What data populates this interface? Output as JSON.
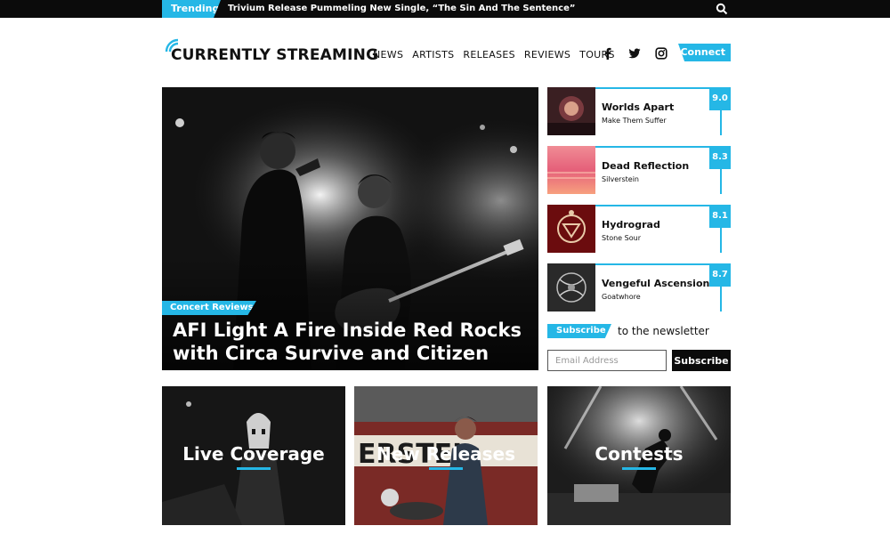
{
  "trending": {
    "label": "Trending",
    "headline": "Trivium Release Pummeling New Single, “The Sin And The Sentence”"
  },
  "header": {
    "logo_text": "CURRENTLY STREAMING",
    "nav": [
      "NEWS",
      "ARTISTS",
      "RELEASES",
      "REVIEWS",
      "TOURS"
    ],
    "connect_label": "Connect",
    "icons": [
      "search-icon",
      "facebook-icon",
      "twitter-icon",
      "instagram-icon"
    ]
  },
  "hero": {
    "category": "Concert Reviews",
    "title": "AFI Light A Fire Inside Red Rocks with Circa Survive and Citizen"
  },
  "reviews": [
    {
      "title": "Worlds Apart",
      "artist": "Make Them Suffer",
      "score": "9.0"
    },
    {
      "title": "Dead Reflection",
      "artist": "Silverstein",
      "score": "8.3"
    },
    {
      "title": "Hydrograd",
      "artist": "Stone Sour",
      "score": "8.1"
    },
    {
      "title": "Vengeful Ascension",
      "artist": "Goatwhore",
      "score": "8.7"
    }
  ],
  "newsletter": {
    "tag": "Subscribe",
    "text": "to the newsletter",
    "placeholder": "Email Address",
    "button": "Subscribe"
  },
  "tiles": [
    {
      "label": "Live Coverage"
    },
    {
      "label": "New Releases"
    },
    {
      "label": "Contests"
    }
  ],
  "colors": {
    "accent": "#25b7e6",
    "bar": "#0b0b0b"
  }
}
